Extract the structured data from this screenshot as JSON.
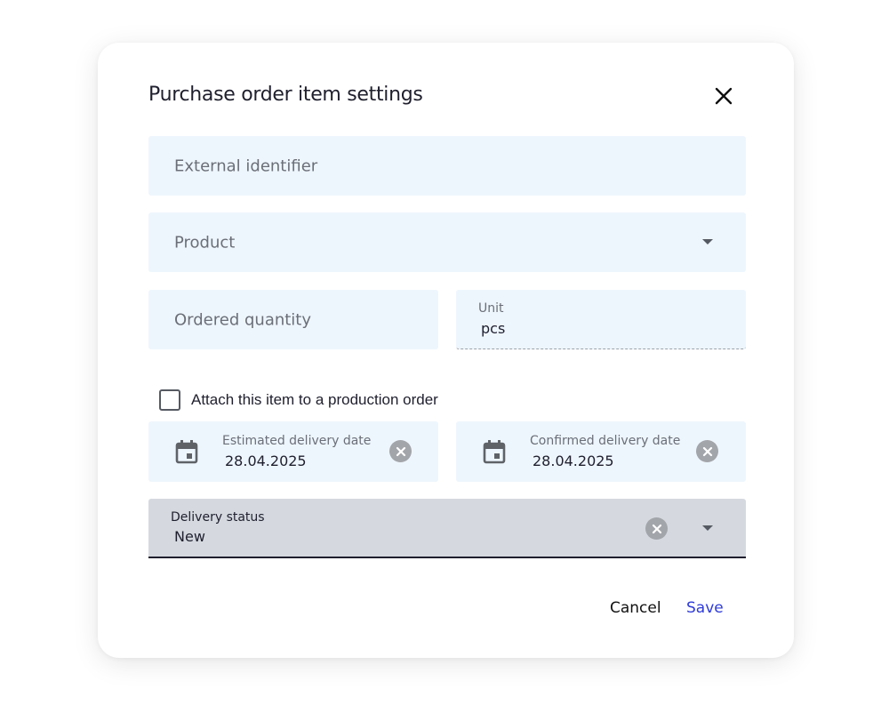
{
  "dialog": {
    "title": "Purchase order item settings",
    "close_icon": "close-icon"
  },
  "fields": {
    "external_identifier": {
      "placeholder": "External identifier"
    },
    "product": {
      "placeholder": "Product"
    },
    "ordered_quantity": {
      "placeholder": "Ordered quantity"
    },
    "unit": {
      "label": "Unit",
      "value": "pcs"
    },
    "attach_production": {
      "label": "Attach this item to a production order",
      "checked": false
    },
    "estimated_delivery": {
      "label": "Estimated delivery date",
      "value": "28.04.2025"
    },
    "confirmed_delivery": {
      "label": "Confirmed delivery date",
      "value": "28.04.2025"
    },
    "delivery_status": {
      "label": "Delivery status",
      "value": "New"
    }
  },
  "actions": {
    "cancel_label": "Cancel",
    "save_label": "Save"
  },
  "colors": {
    "field_bg": "#eef6fd",
    "status_bg": "#d5d9df",
    "save_accent": "#2f3bd9"
  }
}
